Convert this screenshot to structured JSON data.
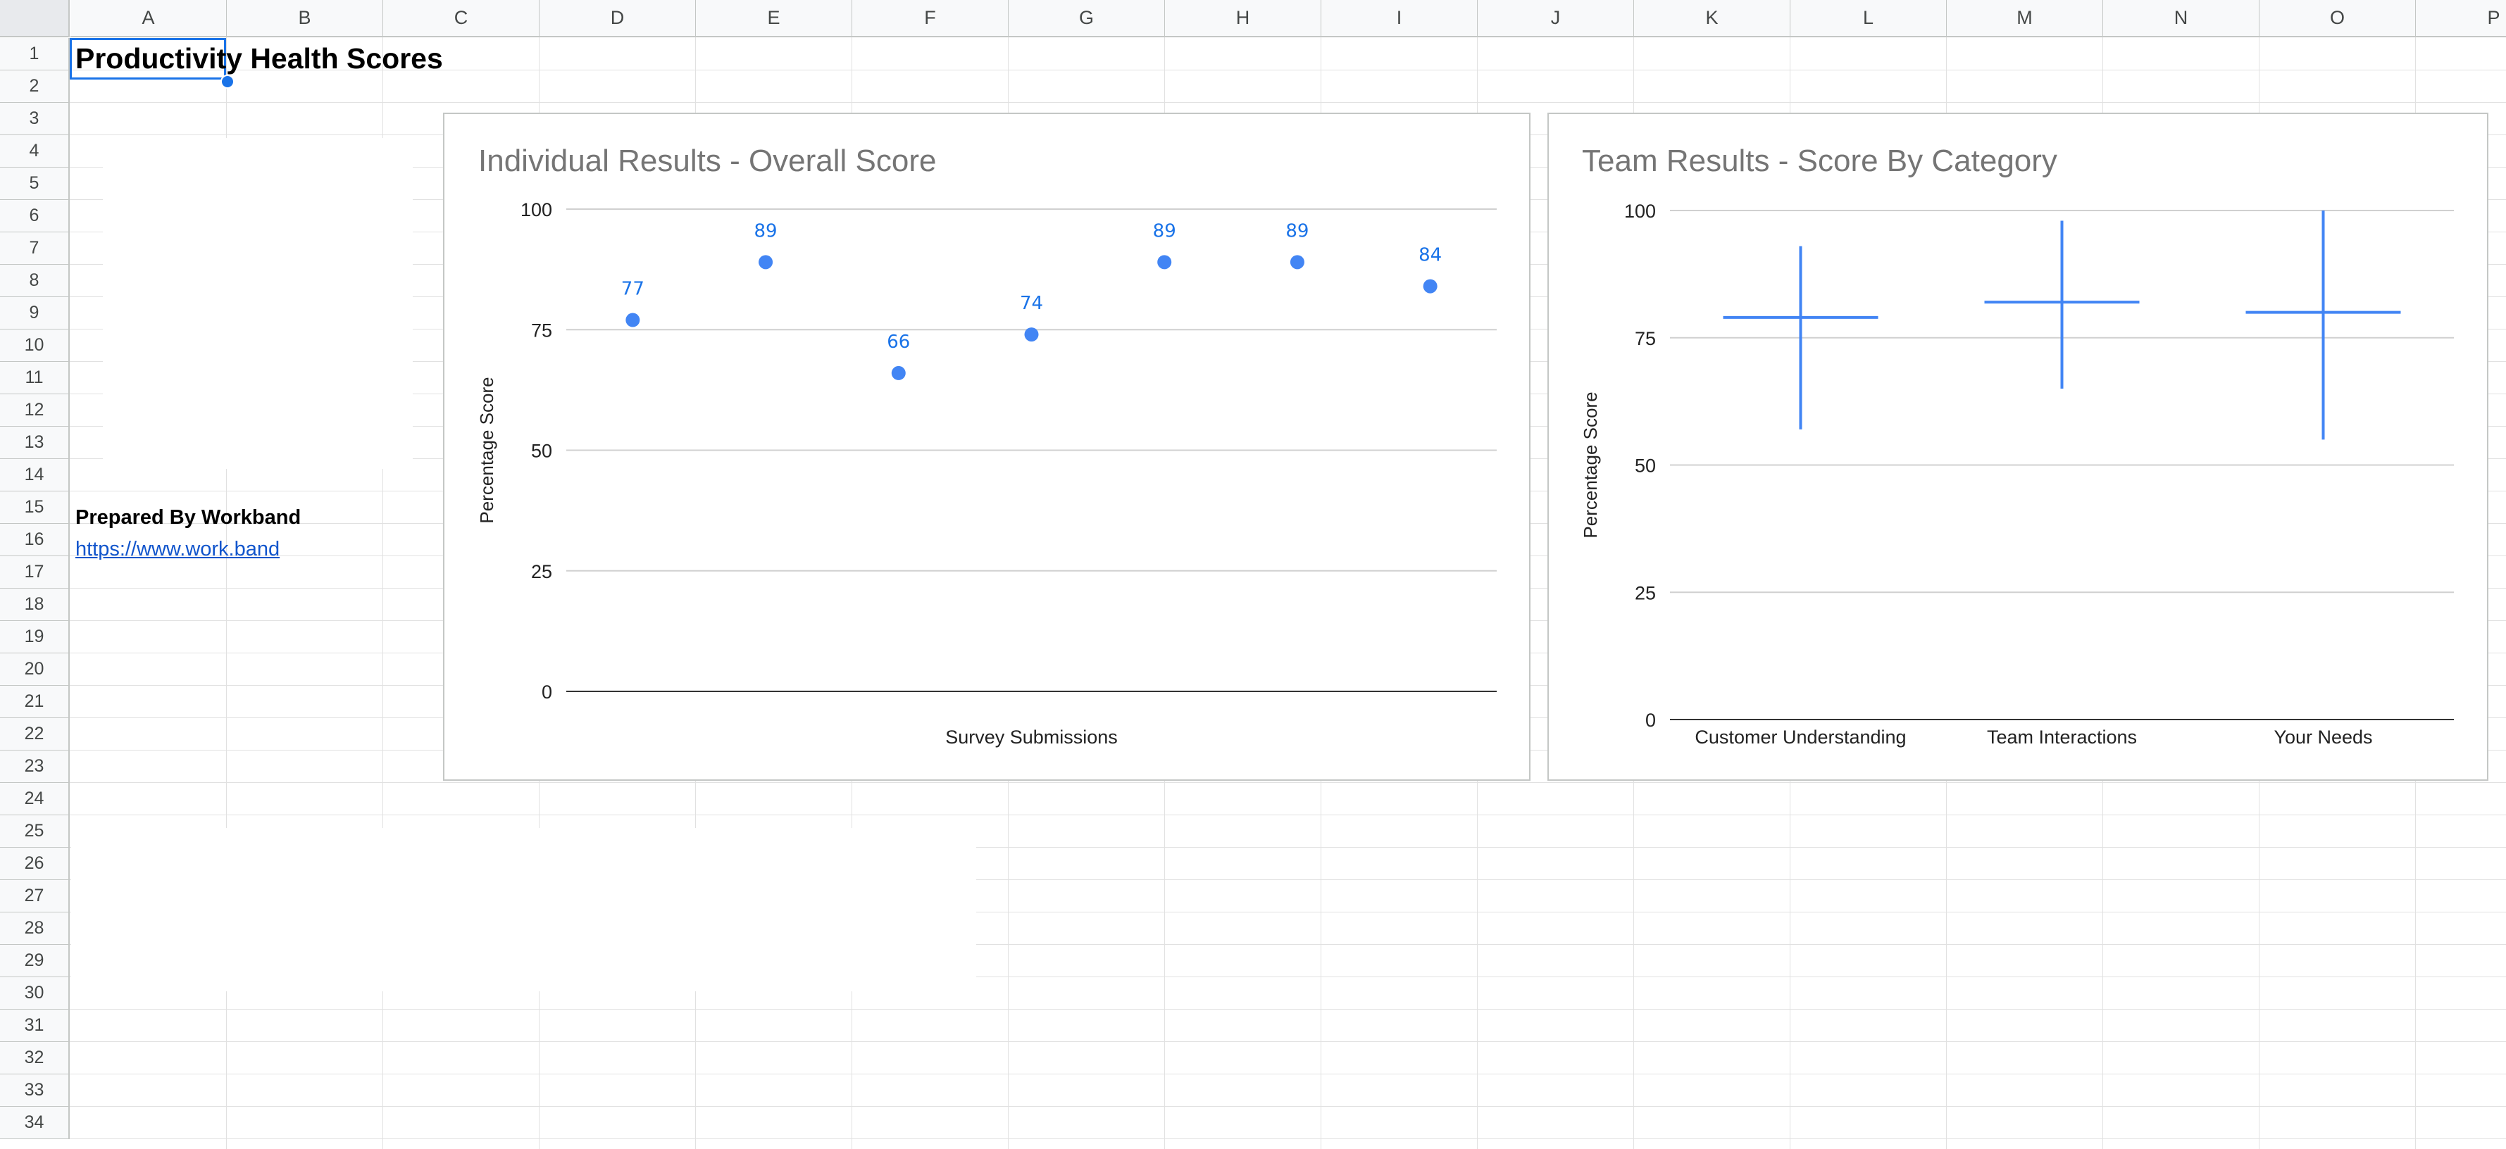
{
  "columns": [
    "A",
    "B",
    "C",
    "D",
    "E",
    "F",
    "G",
    "H",
    "I",
    "J",
    "K",
    "L",
    "M",
    "N",
    "O",
    "P"
  ],
  "rows": [
    "1",
    "2",
    "3",
    "4",
    "5",
    "6",
    "7",
    "8",
    "9",
    "10",
    "11",
    "12",
    "13",
    "14",
    "15",
    "16",
    "17",
    "18",
    "19",
    "20",
    "21",
    "22",
    "23",
    "24",
    "25",
    "26",
    "27",
    "28",
    "29",
    "30",
    "31",
    "32",
    "33",
    "34"
  ],
  "cells": {
    "title": "Productivity Health Scores",
    "prepared_by": "Prepared By Workband",
    "link": "https://www.work.band"
  },
  "colors": {
    "accent": "#4285f4",
    "label": "#1a73e8",
    "selection": "#1a73e8",
    "link": "#1155cc"
  },
  "charts": [
    {
      "id": "individual",
      "title": "Individual Results - Overall Score",
      "chart_data": {
        "type": "scatter",
        "title": "Individual Results - Overall Score",
        "xlabel": "Survey Submissions",
        "ylabel": "Percentage Score",
        "ylim": [
          0,
          100
        ],
        "yticks": [
          "0",
          "25",
          "50",
          "75",
          "100"
        ],
        "x": [
          1,
          2,
          3,
          4,
          5,
          6,
          7
        ],
        "values": [
          77,
          89,
          66,
          74,
          89,
          89,
          84
        ],
        "data_labels": [
          "77",
          "89",
          "66",
          "74",
          "89",
          "89",
          "84"
        ],
        "grid": true,
        "legend": "none"
      }
    },
    {
      "id": "team",
      "title": "Team Results - Score By Category",
      "chart_data": {
        "type": "candlestick",
        "title": "Team Results - Score By Category",
        "xlabel": "",
        "ylabel": "Percentage Score",
        "ylim": [
          0,
          100
        ],
        "yticks": [
          "0",
          "25",
          "50",
          "75",
          "100"
        ],
        "categories": [
          "Customer Understanding",
          "Team Interactions",
          "Your Needs"
        ],
        "low": [
          57,
          65,
          55
        ],
        "high": [
          93,
          98,
          100
        ],
        "value": [
          79,
          82,
          80
        ],
        "grid": true,
        "legend": "none"
      }
    }
  ]
}
